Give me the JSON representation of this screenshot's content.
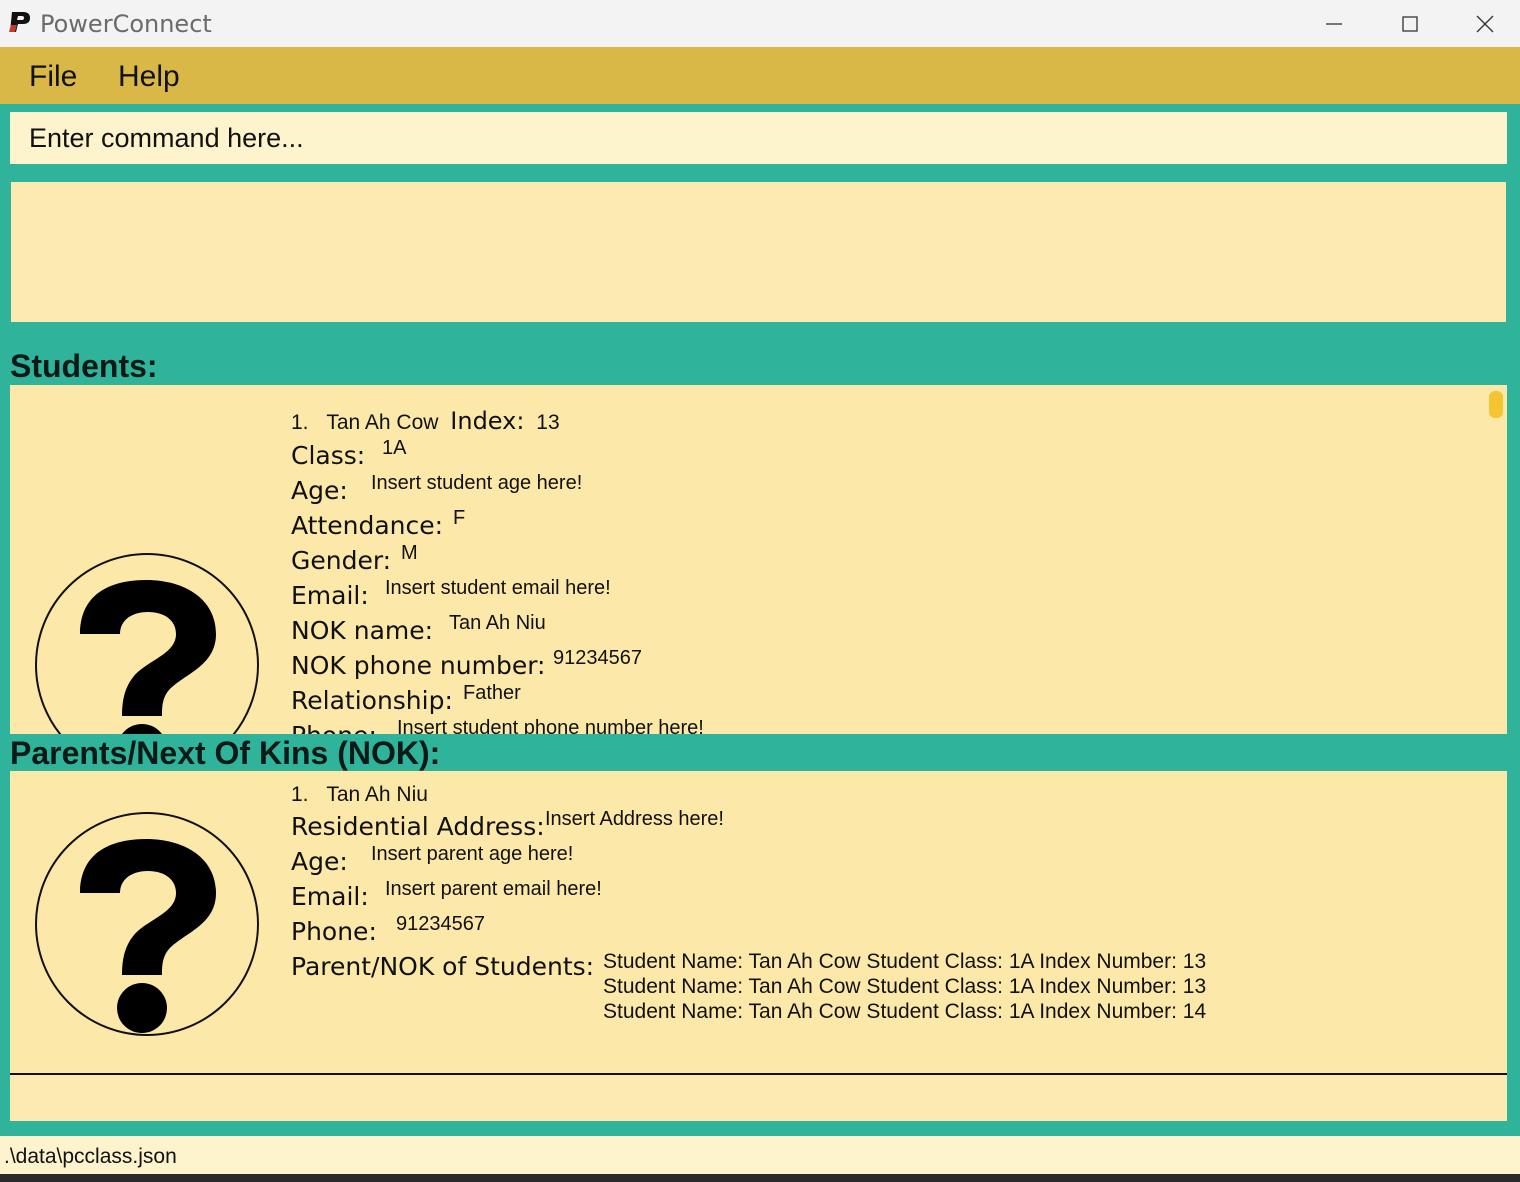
{
  "window": {
    "title": "PowerConnect"
  },
  "menu": {
    "file": "File",
    "help": "Help"
  },
  "command": {
    "placeholder": "Enter command here..."
  },
  "students": {
    "title": "Students:",
    "card": {
      "index_label": "1.",
      "name": "Tan Ah Cow",
      "index_text": "Index:",
      "index_value": "13",
      "class_label": "Class:",
      "class_value": "1A",
      "age_label": "Age:",
      "age_value": "Insert student age here!",
      "attendance_label": "Attendance:",
      "attendance_value": "F",
      "gender_label": "Gender:",
      "gender_value": "M",
      "email_label": "Email:",
      "email_value": "Insert student email here!",
      "nok_name_label": "NOK name:",
      "nok_name_value": "Tan Ah Niu",
      "nok_phone_label": "NOK phone number:",
      "nok_phone_value": "91234567",
      "relationship_label": "Relationship:",
      "relationship_value": "Father",
      "phone_label": "Phone:",
      "phone_value": "Insert student phone number here!"
    }
  },
  "parents": {
    "title": "Parents/Next Of Kins (NOK):",
    "card": {
      "index_label": "1.",
      "name": "Tan Ah Niu",
      "address_label": "Residential Address:",
      "address_value": "Insert Address here!",
      "age_label": "Age:",
      "age_value": "Insert parent age here!",
      "email_label": "Email:",
      "email_value": "Insert parent email here!",
      "phone_label": "Phone:",
      "phone_value": "91234567",
      "students_label": "Parent/NOK of Students:",
      "students": [
        "Student Name: Tan Ah Cow Student Class: 1A Index Number: 13",
        "Student Name: Tan Ah Cow Student Class: 1A Index Number: 13",
        "Student Name: Tan Ah Cow Student Class: 1A Index Number: 14"
      ]
    }
  },
  "status": {
    "path": ".\\data\\pcclass.json"
  },
  "colors": {
    "background": "#2fb39a",
    "menubar": "#d9b847",
    "panel": "#fce8a8",
    "scrollbar": "#f6c433"
  },
  "icons": {
    "avatar": "question-mark-icon",
    "logo": "powerconnect-logo-icon"
  }
}
